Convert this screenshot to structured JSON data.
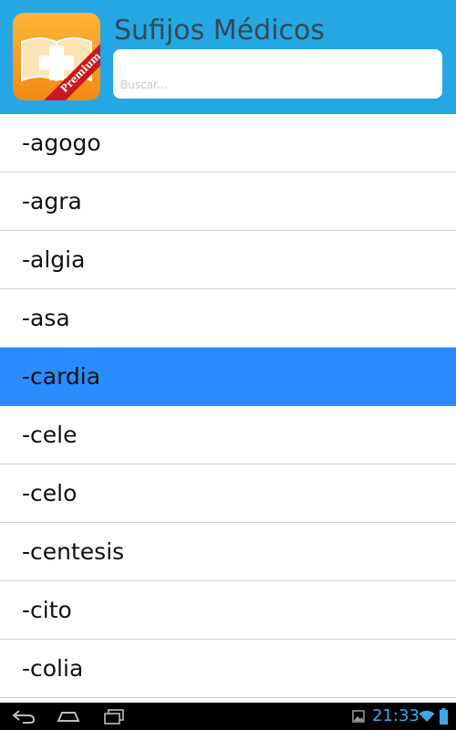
{
  "app": {
    "title": "Sufijos Médicos",
    "badge": "Premium"
  },
  "search": {
    "placeholder": "Buscar..."
  },
  "list": {
    "selected_index": 4,
    "items": [
      "-agogo",
      "-agra",
      "-algia",
      "-asa",
      "-cardia",
      "-cele",
      "-celo",
      "-centesis",
      "-cito",
      "-colia"
    ]
  },
  "status_bar": {
    "time": "21:33"
  },
  "colors": {
    "header_bg": "#25a7e4",
    "selected_row": "#2a8cff",
    "title_text": "#34485a",
    "status_accent": "#3ea8e6"
  },
  "icons": [
    "back-icon",
    "home-icon",
    "recents-icon",
    "gallery-notification-icon",
    "wifi-icon",
    "battery-icon"
  ]
}
